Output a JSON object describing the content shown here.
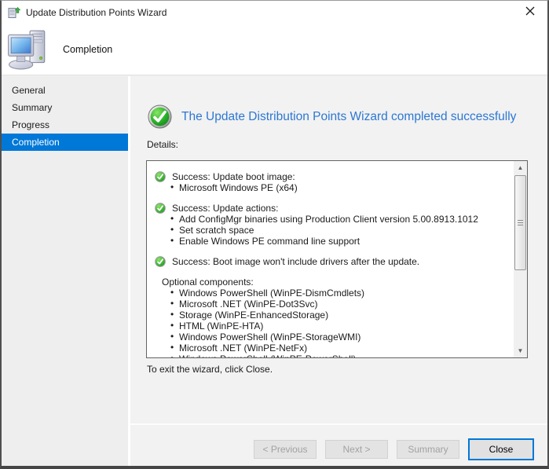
{
  "window": {
    "title": "Update Distribution Points Wizard"
  },
  "header": {
    "title": "Completion"
  },
  "sidebar": {
    "items": [
      {
        "label": "General",
        "active": false
      },
      {
        "label": "Summary",
        "active": false
      },
      {
        "label": "Progress",
        "active": false
      },
      {
        "label": "Completion",
        "active": true
      }
    ]
  },
  "main": {
    "status_heading": "The Update Distribution Points Wizard completed successfully",
    "details_label": "Details:",
    "details_lines": [
      {
        "type": "success",
        "text": "Success: Update boot image:"
      },
      {
        "type": "bullet",
        "text": "Microsoft Windows PE (x64)"
      },
      {
        "type": "spacer",
        "text": ""
      },
      {
        "type": "success",
        "text": "Success: Update actions:"
      },
      {
        "type": "bullet",
        "text": "Add ConfigMgr binaries using Production Client version 5.00.8913.1012"
      },
      {
        "type": "bullet",
        "text": "Set scratch space"
      },
      {
        "type": "bullet",
        "text": "Enable Windows PE command line support"
      },
      {
        "type": "spacer",
        "text": ""
      },
      {
        "type": "success",
        "text": "Success: Boot image won't include drivers after the update."
      },
      {
        "type": "spacer",
        "text": ""
      },
      {
        "type": "plain",
        "text": "Optional components:"
      },
      {
        "type": "bullet",
        "text": "Windows PowerShell (WinPE-DismCmdlets)"
      },
      {
        "type": "bullet",
        "text": "Microsoft .NET (WinPE-Dot3Svc)"
      },
      {
        "type": "bullet",
        "text": "Storage (WinPE-EnhancedStorage)"
      },
      {
        "type": "bullet",
        "text": "HTML (WinPE-HTA)"
      },
      {
        "type": "bullet",
        "text": "Windows PowerShell (WinPE-StorageWMI)"
      },
      {
        "type": "bullet",
        "text": "Microsoft .NET (WinPE-NetFx)"
      },
      {
        "type": "bullet",
        "text": "Windows PowerShell (WinPE-PowerShell)"
      }
    ],
    "exit_hint": "To exit the wizard, click Close."
  },
  "footer": {
    "buttons": [
      {
        "name": "previous-button",
        "label": "< Previous",
        "enabled": false,
        "default": false
      },
      {
        "name": "next-button",
        "label": "Next >",
        "enabled": false,
        "default": false
      },
      {
        "name": "summary-button",
        "label": "Summary",
        "enabled": false,
        "default": false
      },
      {
        "name": "close-button",
        "label": "Close",
        "enabled": true,
        "default": true
      }
    ]
  },
  "icons": {
    "titlebar": "update-distribution-wizard-icon",
    "header": "computer-icon",
    "status": "success-check-icon",
    "close": "close-icon",
    "scroll_up": "scroll-up-icon",
    "scroll_down": "scroll-down-icon"
  },
  "colors": {
    "accent": "#0078d7",
    "heading_blue": "#2c77d4",
    "success_green": "#1a9a1f",
    "titlebar_bg": "#ffffff",
    "sidebar_bg": "#eeeeee",
    "details_border": "#646464"
  }
}
